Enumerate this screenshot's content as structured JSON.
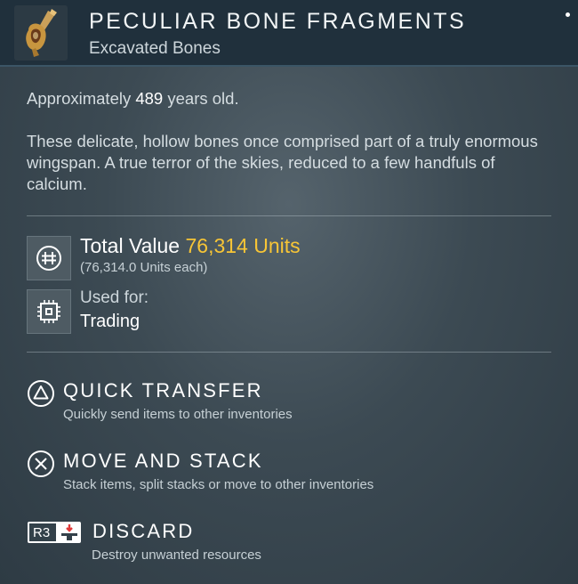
{
  "item": {
    "title": "PECULIAR BONE FRAGMENTS",
    "subtitle": "Excavated Bones",
    "icon": "bone-fragment-icon"
  },
  "age": {
    "prefix": "Approximately ",
    "value": "489",
    "suffix": " years old."
  },
  "description": "These delicate, hollow bones once comprised part of a truly enormous wingspan. A true terror of the skies, reduced to a few handfuls of calcium.",
  "value_info": {
    "label": "Total Value ",
    "total": "76,314 Units",
    "each": "(76,314.0 Units each)",
    "icon": "currency-icon"
  },
  "used_for": {
    "label": "Used for:",
    "value": "Trading",
    "icon": "trading-chip-icon"
  },
  "actions": [
    {
      "label": "QUICK TRANSFER",
      "description": "Quickly send items to other inventories",
      "button": "triangle-button-icon"
    },
    {
      "label": "MOVE AND STACK",
      "description": "Stack items, split stacks or move to other inventories",
      "button": "cross-button-icon"
    },
    {
      "label": "DISCARD",
      "description": "Destroy unwanted resources",
      "button": "R3"
    }
  ],
  "colors": {
    "accent_value": "#f7c536",
    "header_bg": "#20303c",
    "panel_bg": "#33414a",
    "discard_red": "#e03a3a"
  }
}
